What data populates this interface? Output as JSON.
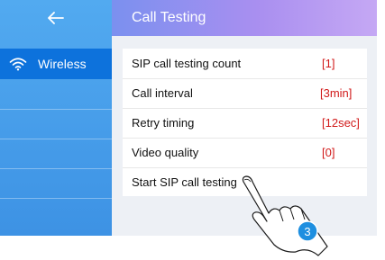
{
  "sidebar": {
    "back_icon": "left-arrow-icon",
    "items": [
      {
        "label": "Wireless",
        "icon": "wifi-icon",
        "selected": true
      }
    ]
  },
  "header": {
    "title": "Call Testing"
  },
  "settings": [
    {
      "label": "SIP call testing count",
      "value": "[1]"
    },
    {
      "label": "Call interval",
      "value": "[3min]"
    },
    {
      "label": "Retry timing",
      "value": "[12sec]"
    },
    {
      "label": "Video quality",
      "value": "[0]"
    },
    {
      "label": "Start SIP call testing"
    }
  ],
  "callout": {
    "step": "3",
    "icon": "pointing-hand-icon"
  },
  "colors": {
    "sidebar": "#4a9fe9",
    "selected_item": "#0d72dc",
    "value_text": "#d11a1a",
    "step_badge": "#1e8fe0"
  }
}
